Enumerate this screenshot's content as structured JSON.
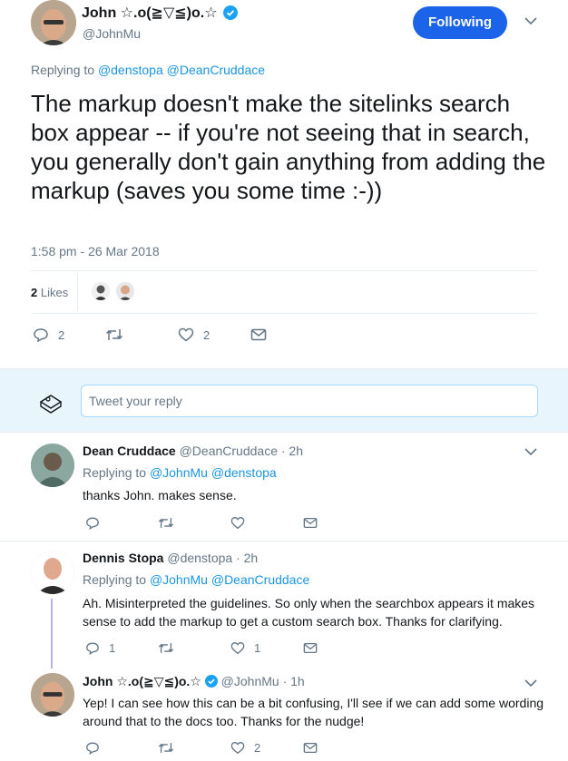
{
  "main_tweet": {
    "author_name": "John ☆.o(≧▽≦)o.☆",
    "author_handle": "@JohnMu",
    "follow_label": "Following",
    "replying_prefix": "Replying to",
    "replying_to": [
      "@denstopa",
      "@DeanCruddace"
    ],
    "text": "The markup doesn't make the sitelinks search box appear -- if you're not seeing that in search, you generally don't gain anything from adding the markup (saves you some time :-))",
    "timestamp": "1:58 pm - 26 Mar 2018",
    "likes_count": "2",
    "likes_label": "Likes",
    "reply_count": "2",
    "retweet_count": "",
    "like_count": "2"
  },
  "composer": {
    "placeholder": "Tweet your reply"
  },
  "replies": [
    {
      "name": "Dean Cruddace",
      "handle": "@DeanCruddace",
      "time": "· 2h",
      "replying_prefix": "Replying to",
      "replying_to": [
        "@JohnMu",
        "@denstopa"
      ],
      "text": "thanks John. makes sense.",
      "reply_count": "",
      "like_count": ""
    },
    {
      "name": "Dennis Stopa",
      "handle": "@denstopa",
      "time": "· 2h",
      "replying_prefix": "Replying to",
      "replying_to": [
        "@JohnMu",
        "@DeanCruddace"
      ],
      "text": "Ah. Misinterpreted the guidelines. So only when the searchbox appears it makes sense to add the markup to get a custom search box. Thanks for clarifying.",
      "reply_count": "1",
      "like_count": "1"
    },
    {
      "name": "John ☆.o(≧▽≦)o.☆",
      "handle": "@JohnMu",
      "time": "· 1h",
      "text": "Yep! I can see how this can be a bit confusing, I'll see if we can add some wording around that to the docs too. Thanks for the nudge!",
      "reply_count": "",
      "like_count": "2"
    }
  ],
  "colors": {
    "accent": "#1b95e0",
    "follow_button": "#1b63e8",
    "verified": "#1da1f2",
    "thread_line": "#b8b2f0"
  }
}
